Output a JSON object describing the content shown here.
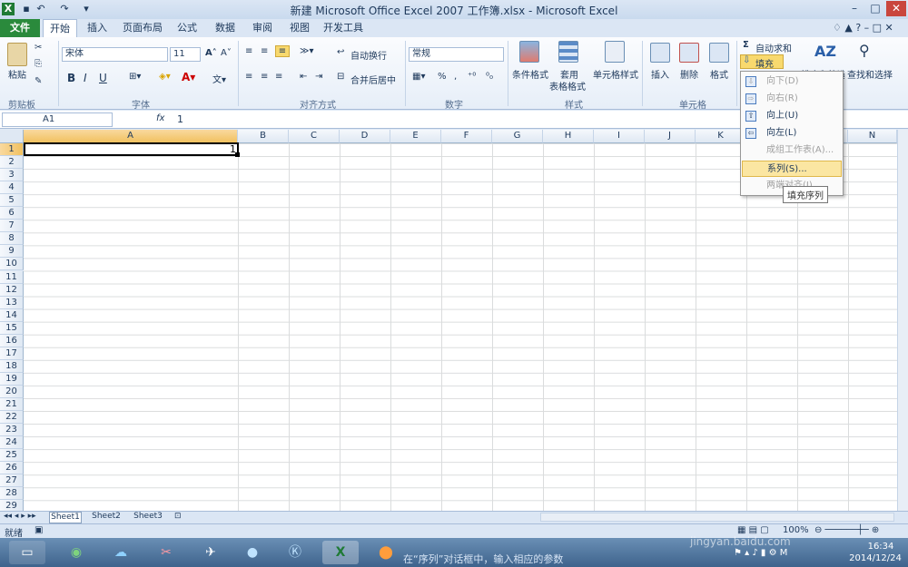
{
  "window": {
    "title": "新建 Microsoft Office Excel 2007 工作簿.xlsx - Microsoft Excel"
  },
  "tabs": [
    "文件",
    "开始",
    "插入",
    "页面布局",
    "公式",
    "数据",
    "审阅",
    "视图",
    "开发工具"
  ],
  "clipboard": {
    "paste": "粘贴",
    "label": "剪贴板"
  },
  "font": {
    "name": "宋体",
    "size": "11",
    "label": "字体",
    "bold": "B",
    "italic": "I",
    "underline": "U"
  },
  "alignment": {
    "wrap": "自动换行",
    "merge": "合并后居中",
    "label": "对齐方式"
  },
  "number": {
    "format": "常规",
    "percent": "%",
    "comma": ",",
    "label": "数字"
  },
  "styles": {
    "conditional": "条件格式",
    "table1": "套用",
    "table2": "表格格式",
    "cellstyle": "单元格样式",
    "label": "样式"
  },
  "cells": {
    "insert": "插入",
    "delete": "删除",
    "format": "格式",
    "label": "单元格"
  },
  "editing": {
    "autosum": "自动求和",
    "fill": "填充",
    "sort": "排序和筛选",
    "find": "查找和选择"
  },
  "fill_menu": {
    "items": [
      {
        "label": "向下(D)",
        "enabled": false
      },
      {
        "label": "向右(R)",
        "enabled": false
      },
      {
        "label": "向上(U)",
        "enabled": true
      },
      {
        "label": "向左(L)",
        "enabled": true
      },
      {
        "label": "成组工作表(A)...",
        "enabled": false
      },
      {
        "label": "系列(S)...",
        "enabled": true
      },
      {
        "label": "两端对齐(J)",
        "enabled": false
      }
    ],
    "tooltip": "填充序列"
  },
  "formula_bar": {
    "cell": "A1",
    "fx": "fx",
    "value": "1"
  },
  "columns": [
    "A",
    "B",
    "C",
    "D",
    "E",
    "F",
    "G",
    "H",
    "I",
    "J",
    "K",
    "L",
    "M",
    "N"
  ],
  "rows": [
    "1",
    "2",
    "3",
    "4",
    "5",
    "6",
    "7",
    "8",
    "9",
    "10",
    "11",
    "12",
    "13",
    "14",
    "15",
    "16",
    "17",
    "18",
    "19",
    "20",
    "21",
    "22",
    "23",
    "24",
    "25",
    "26",
    "27",
    "28",
    "29"
  ],
  "cell_a1": "1",
  "sheets": [
    "Sheet1",
    "Sheet2",
    "Sheet3"
  ],
  "status": {
    "ready": "就绪",
    "zoom": "100%"
  },
  "taskbar": {
    "time": "16:34",
    "date": "2014/12/24",
    "caption": "在“序列”对话框中，输入相应的参数"
  },
  "watermark": "jingyan.baidu.com"
}
